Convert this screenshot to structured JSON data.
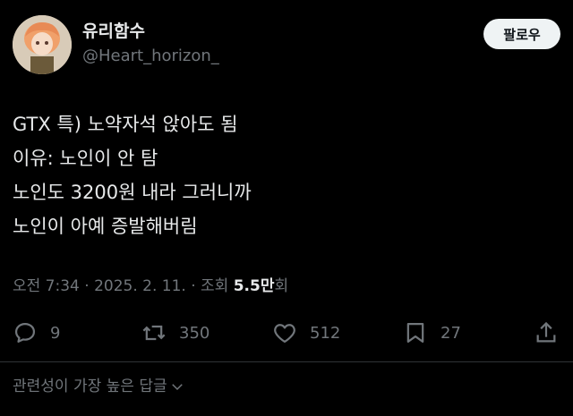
{
  "user": {
    "display_name": "유리함수",
    "handle": "@Heart_horizon_",
    "follow_label": "팔로우"
  },
  "tweet": {
    "lines": [
      "GTX 특) 노약자석 앉아도 됨",
      "이유: 노인이 안 탐",
      "노인도 3200원 내라 그러니까",
      "노인이 아예 증발해버림"
    ]
  },
  "meta": {
    "time": "오전 7:34",
    "separator": " · ",
    "date": "2025. 2. 11.",
    "views_label": "조회",
    "views_count": "5.5만",
    "views_suffix": "회"
  },
  "actions": {
    "replies": "9",
    "retweets": "350",
    "likes": "512",
    "bookmarks": "27"
  },
  "related": {
    "label": "관련성이 가장 높은 답글"
  },
  "colors": {
    "background": "#000000",
    "text": "#e7e9ea",
    "muted": "#71767b",
    "button_bg": "#eff3f4"
  }
}
